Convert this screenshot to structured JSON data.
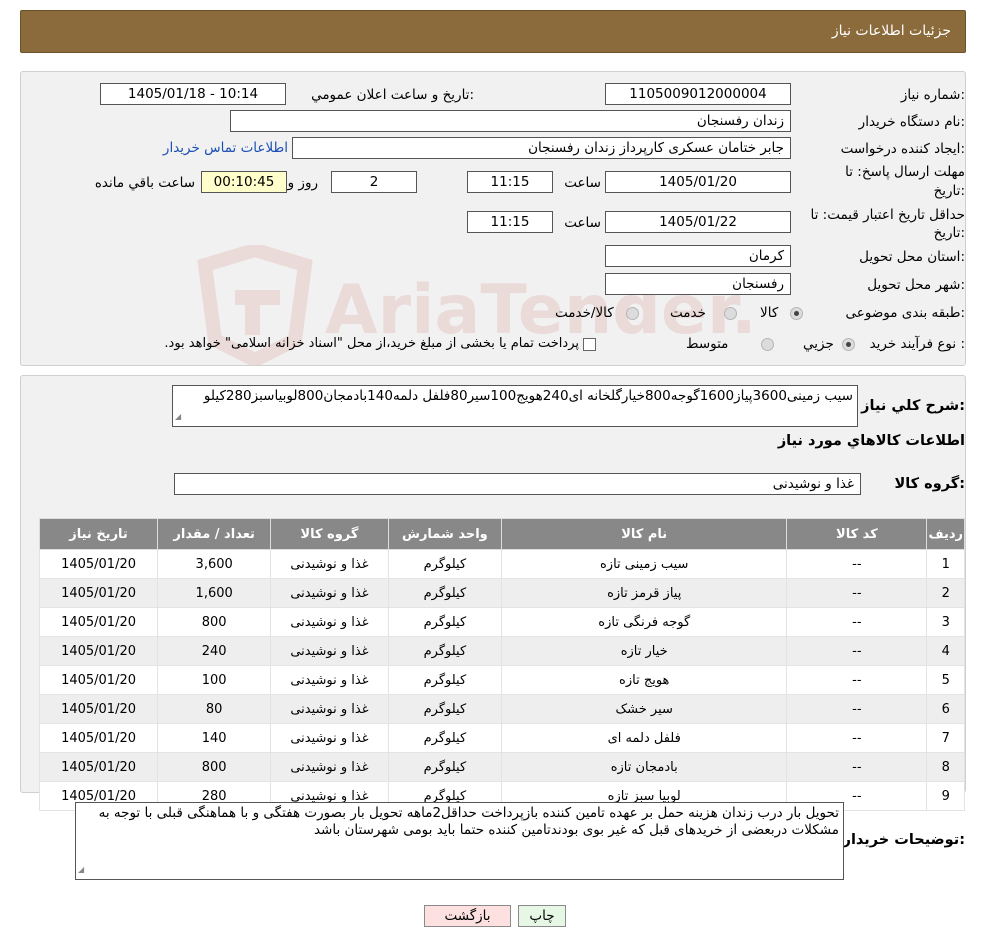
{
  "header": {
    "title": "جزئيات اطلاعات نياز"
  },
  "labels": {
    "need_number": "شماره نياز:",
    "announce_datetime": "تاريخ و ساعت اعلان عمومي:",
    "buyer_org": "نام دستگاه خريدار:",
    "requester": "ايجاد کننده درخواست:",
    "contact_link": "اطلاعات تماس خريدار",
    "response_deadline_1": "مهلت ارسال پاسخ: تا",
    "response_deadline_2": "تاريخ:",
    "time": "ساعت",
    "days": "روز و",
    "remaining": "ساعت باقي مانده",
    "price_validity_1": "حداقل تاريخ اعتبار قيمت: تا",
    "price_validity_2": "تاريخ:",
    "province": "استان محل تحويل:",
    "city": "شهر محل تحويل:",
    "category": "طبقه بندی موضوعی:",
    "purchase_type": "نوع فرآيند خريد :",
    "description": "شرح کلي نياز:",
    "goods_info": "اطلاعات کالاهاي مورد نياز",
    "goods_group": "گروه کالا:",
    "buyer_notes": "توضيحات خريدار:"
  },
  "values": {
    "need_number": "1105009012000004",
    "announce_datetime": "1405/01/18 - 10:14",
    "buyer_org": "زندان رفسنجان",
    "requester": "جابر ختامان عسکری کارپرداز زندان رفسنجان",
    "response_date": "1405/01/20",
    "response_time": "11:15",
    "days": "2",
    "remaining_time": "00:10:45",
    "validity_date": "1405/01/22",
    "validity_time": "11:15",
    "province": "کرمان",
    "city": "رفسنجان",
    "goods_group": "غذا و نوشيدنی"
  },
  "category_options": [
    {
      "label": "کالا",
      "selected": true
    },
    {
      "label": "خدمت",
      "selected": false
    },
    {
      "label": "کالا/خدمت",
      "selected": false
    }
  ],
  "purchase_options": [
    {
      "label": "جزيي",
      "selected": true
    },
    {
      "label": "متوسط",
      "selected": false
    }
  ],
  "purchase_note": "پرداخت تمام يا بخشی از مبلغ خريد،از محل \"اسناد خزانه اسلامی\" خواهد بود.",
  "description_text": "سیب زمینی3600پیاز1600گوجه800خیارگلخانه ای240هویج100سیر80فلفل دلمه140بادمجان800لوبیاسبز280کیلو",
  "notes_text": "تحویل بار درب زندان هزینه حمل بر عهده تامین کننده بازپرداخت حداقل2ماهه تحویل بار بصورت هفتگی و با هماهنگی قبلی با توجه به مشکلات دربعضی از خریدهای قبل که غیر بوی بودندتامین کننده حتما باید بومی شهرستان باشد",
  "watermark": "AriaTender.neT",
  "table": {
    "headers": [
      "رديف",
      "کد کالا",
      "نام کالا",
      "واحد شمارش",
      "گروه کالا",
      "تعداد / مقدار",
      "تاريخ نياز"
    ],
    "rows": [
      [
        "1",
        "--",
        "سیب زمینی تازه",
        "کيلوگرم",
        "غذا و نوشيدنی",
        "3,600",
        "1405/01/20"
      ],
      [
        "2",
        "--",
        "پیاز قرمز تازه",
        "کيلوگرم",
        "غذا و نوشيدنی",
        "1,600",
        "1405/01/20"
      ],
      [
        "3",
        "--",
        "گوجه فرنگی تازه",
        "کيلوگرم",
        "غذا و نوشيدنی",
        "800",
        "1405/01/20"
      ],
      [
        "4",
        "--",
        "خیار تازه",
        "کيلوگرم",
        "غذا و نوشيدنی",
        "240",
        "1405/01/20"
      ],
      [
        "5",
        "--",
        "هویج تازه",
        "کيلوگرم",
        "غذا و نوشيدنی",
        "100",
        "1405/01/20"
      ],
      [
        "6",
        "--",
        "سیر خشک",
        "کيلوگرم",
        "غذا و نوشيدنی",
        "80",
        "1405/01/20"
      ],
      [
        "7",
        "--",
        "فلفل دلمه ای",
        "کيلوگرم",
        "غذا و نوشيدنی",
        "140",
        "1405/01/20"
      ],
      [
        "8",
        "--",
        "بادمجان تازه",
        "کيلوگرم",
        "غذا و نوشيدنی",
        "800",
        "1405/01/20"
      ],
      [
        "9",
        "--",
        "لوبیا سبز تازه",
        "کيلوگرم",
        "غذا و نوشيدنی",
        "280",
        "1405/01/20"
      ]
    ]
  },
  "buttons": {
    "print": "چاپ",
    "back": "بازگشت"
  },
  "colors": {
    "header_bg": "#8b6a3b",
    "table_header_bg": "#888888",
    "remaining_bg": "#ffffcc",
    "back_button_bg": "#fde0e0",
    "print_button_bg": "#e6f7e6"
  }
}
